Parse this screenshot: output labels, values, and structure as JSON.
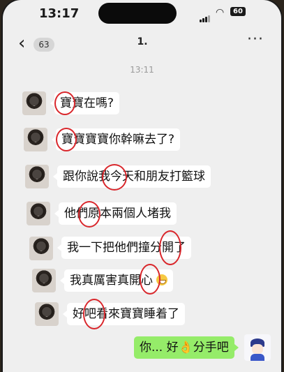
{
  "status_bar": {
    "time": "13:17",
    "battery": "60",
    "wifi_glyph": "wifi-icon",
    "signal_glyph": "signal-icon"
  },
  "nav": {
    "back_glyph": "‹",
    "unread_count": "63",
    "title": "1.",
    "more_glyph": "···"
  },
  "timestamp": "13:11",
  "messages": [
    {
      "text": "寶寶在嗎?",
      "from": "other"
    },
    {
      "text": "寶寶寶寶你幹嘛去了?",
      "from": "other"
    },
    {
      "text": "跟你說我今天和朋友打籃球",
      "from": "other"
    },
    {
      "text": "他們原本兩個人堵我",
      "from": "other"
    },
    {
      "text": "我一下把他們撞分開了",
      "from": "other"
    },
    {
      "text": "我真厲害真開心",
      "from": "other",
      "emoji": "grinning-emoji"
    },
    {
      "text": "好吧看來寶寶睡着了",
      "from": "other"
    },
    {
      "text": "你... 好",
      "from": "me",
      "emoji": "ok-hand-emoji",
      "text_after": "分手吧"
    }
  ],
  "colors": {
    "bubble_me": "#95ec69",
    "bubble_other": "#ffffff",
    "highlight_circle": "#d9262b",
    "background": "#efefef"
  }
}
